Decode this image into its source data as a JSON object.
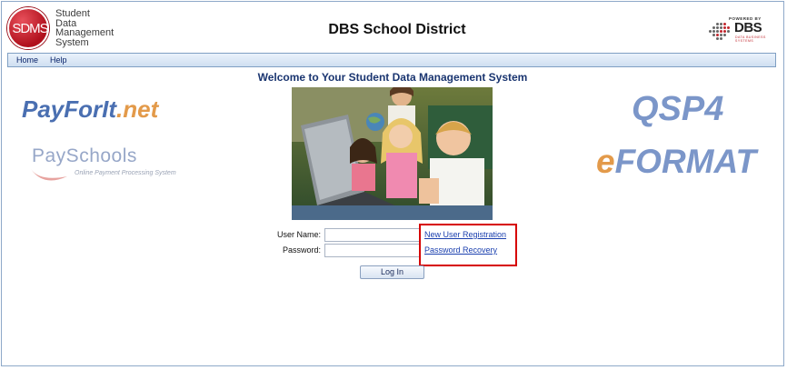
{
  "header": {
    "logo_badge": "SDMS",
    "logo_words": [
      "Student",
      "Data",
      "Management",
      "System"
    ],
    "title": "DBS School District",
    "partner_logo": {
      "powered_by": "POWERED BY",
      "name": "DBS",
      "sub": "DATA BUSINESS SYSTEMS"
    }
  },
  "menu": {
    "items": [
      {
        "label": "Home"
      },
      {
        "label": "Help"
      }
    ]
  },
  "main": {
    "welcome": "Welcome to Your Student Data Management System"
  },
  "logos_left": {
    "payforit_part1": "PayForIt",
    "payforit_part2": ".net",
    "payschools": "PaySchools",
    "payschools_sub": "Online Payment Processing System"
  },
  "logos_right": {
    "qsp4": "QSP4",
    "eformat_e": "e",
    "eformat_rest": "FORMAT"
  },
  "login": {
    "username_label": "User Name:",
    "username_value": "",
    "password_label": "Password:",
    "password_value": "",
    "login_button": "Log In",
    "new_user_link": "New User Registration",
    "password_recovery_link": "Password Recovery"
  },
  "colors": {
    "brand_red": "#b0101c",
    "link_blue": "#1a3fae",
    "title_navy": "#1a3570",
    "highlight_red": "#d60000",
    "logo_blue": "#7b96c9",
    "logo_orange": "#e39a4a"
  }
}
